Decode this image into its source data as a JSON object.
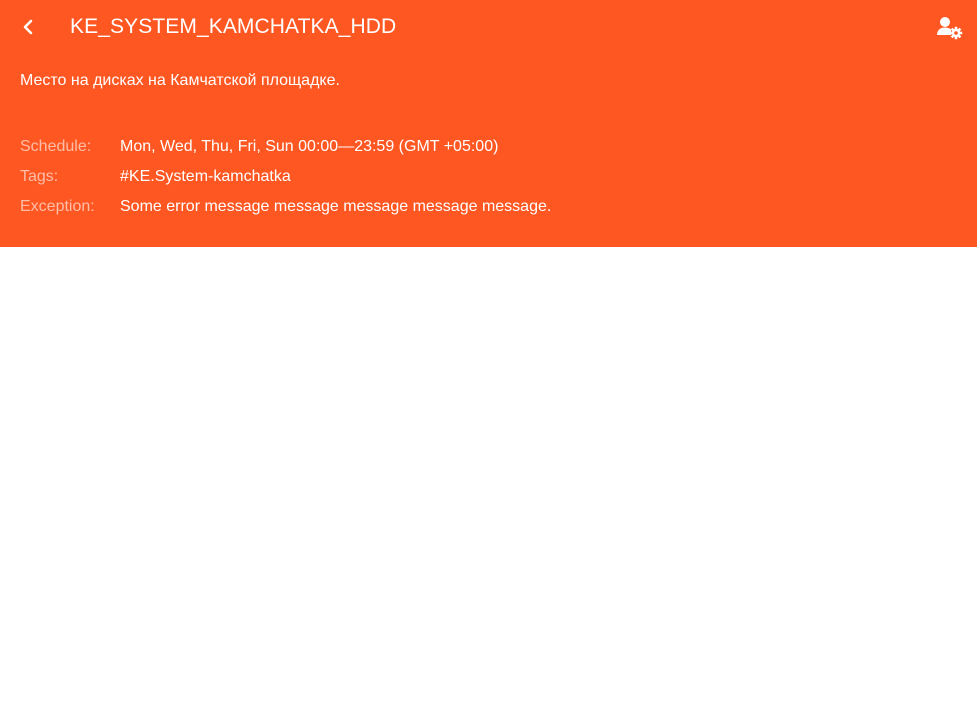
{
  "header": {
    "background_color": "#ff5722",
    "back_icon": "chevron-left-icon",
    "title": "KE_SYSTEM_KAMCHATKA_HDD",
    "settings_icon": "user-settings-icon",
    "description": "Место на дисках на Камчатской площадке."
  },
  "details": {
    "schedule": {
      "label": "Schedule:",
      "value": "Mon, Wed, Thu, Fri, Sun 00:00—23:59 (GMT +05:00)"
    },
    "tags": {
      "label": "Tags:",
      "value": "#KE.System-kamchatka"
    },
    "exception": {
      "label": "Exception:",
      "value": "Some error message message message message message."
    }
  }
}
